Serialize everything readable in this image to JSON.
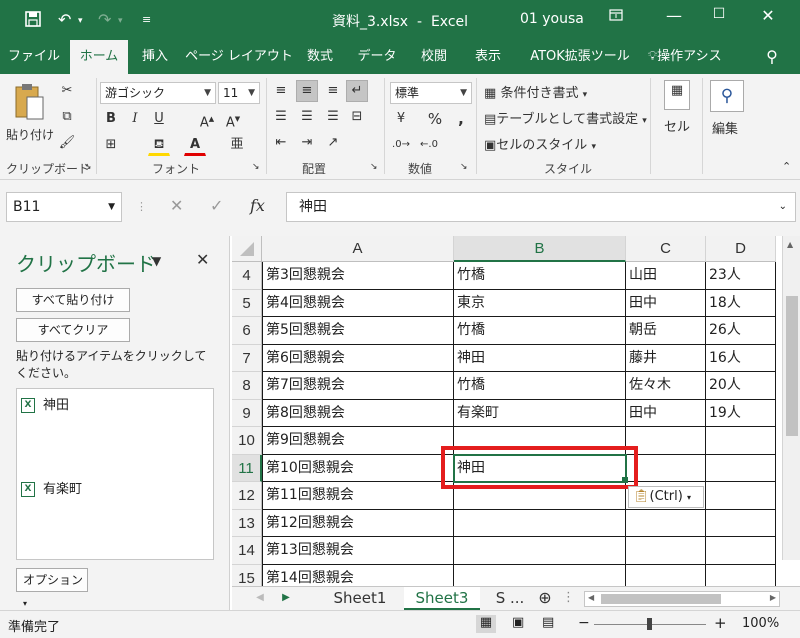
{
  "titlebar": {
    "filename": "資料_3.xlsx",
    "separator": "-",
    "app": "Excel",
    "user": "01 yousa",
    "save_icon": "save-icon",
    "undo_icon": "undo-icon",
    "redo_icon": "redo-icon"
  },
  "tabs": [
    "ファイル",
    "ホーム",
    "挿入",
    "ページ レイアウト",
    "数式",
    "データ",
    "校閲",
    "表示",
    "ATOK拡張ツール",
    "操作アシス"
  ],
  "ribbon": {
    "paste_label": "貼り付け",
    "clipboard_group": "クリップボード",
    "font_name": "游ゴシック",
    "font_size": "11",
    "font_group": "フォント",
    "align_group": "配置",
    "number_format": "標準",
    "percent": "%",
    "comma": ",",
    "number_group": "数値",
    "conditional_format": "条件付き書式",
    "format_as_table": "テーブルとして書式設定",
    "cell_styles": "セルのスタイル",
    "styles_group": "スタイル",
    "cells_label": "セル",
    "edit_label": "編集"
  },
  "formula_bar": {
    "name_box": "B11",
    "formula": "神田",
    "fx": "fx"
  },
  "clipboard_pane": {
    "title": "クリップボード",
    "paste_all": "すべて貼り付け",
    "clear_all": "すべてクリア",
    "instruction": "貼り付けるアイテムをクリックしてください。",
    "items": [
      "神田",
      "有楽町"
    ],
    "options": "オプション"
  },
  "grid": {
    "columns": [
      "A",
      "B",
      "C",
      "D"
    ],
    "rows": [
      {
        "num": "4",
        "a": "第3回懇親会",
        "b": "竹橋",
        "c": "山田",
        "d": "23人"
      },
      {
        "num": "5",
        "a": "第4回懇親会",
        "b": "東京",
        "c": "田中",
        "d": "18人"
      },
      {
        "num": "6",
        "a": "第5回懇親会",
        "b": "竹橋",
        "c": "朝岳",
        "d": "26人"
      },
      {
        "num": "7",
        "a": "第6回懇親会",
        "b": "神田",
        "c": "藤井",
        "d": "16人"
      },
      {
        "num": "8",
        "a": "第7回懇親会",
        "b": "竹橋",
        "c": "佐々木",
        "d": "20人"
      },
      {
        "num": "9",
        "a": "第8回懇親会",
        "b": "有楽町",
        "c": "田中",
        "d": "19人"
      },
      {
        "num": "10",
        "a": "第9回懇親会",
        "b": "",
        "c": "",
        "d": ""
      },
      {
        "num": "11",
        "a": "第10回懇親会",
        "b": "神田",
        "c": "",
        "d": ""
      },
      {
        "num": "12",
        "a": "第11回懇親会",
        "b": "",
        "c": "",
        "d": ""
      },
      {
        "num": "13",
        "a": "第12回懇親会",
        "b": "",
        "c": "",
        "d": ""
      },
      {
        "num": "14",
        "a": "第13回懇親会",
        "b": "",
        "c": "",
        "d": ""
      },
      {
        "num": "15",
        "a": "第14回懇親会",
        "b": "",
        "c": "",
        "d": ""
      }
    ],
    "paste_options": "(Ctrl)"
  },
  "sheets": [
    "Sheet1",
    "Sheet3",
    "S ..."
  ],
  "status": {
    "ready": "準備完了",
    "zoom": "100%"
  },
  "colors": {
    "excel_green": "#217346",
    "highlight_red": "#e41d1d"
  }
}
